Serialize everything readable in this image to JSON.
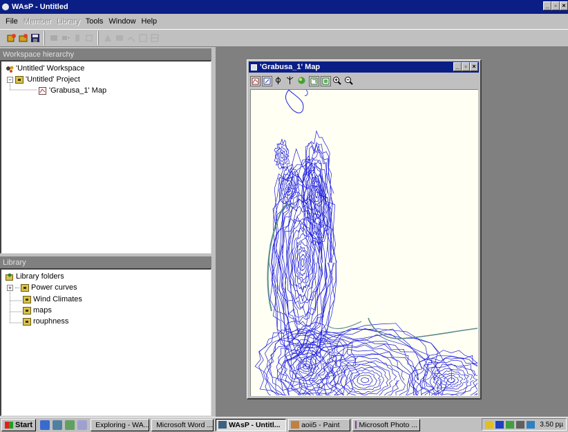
{
  "window": {
    "title": "WAsP - Untitled",
    "btn_min": "_",
    "btn_max": "▫",
    "btn_close": "×"
  },
  "menu": [
    {
      "label": "File",
      "enabled": true
    },
    {
      "label": "Member",
      "enabled": false
    },
    {
      "label": "Library",
      "enabled": false
    },
    {
      "label": "Tools",
      "enabled": true
    },
    {
      "label": "Window",
      "enabled": true
    },
    {
      "label": "Help",
      "enabled": true
    }
  ],
  "workspace_panel": {
    "header": "Workspace hierarchy",
    "items": [
      {
        "label": "'Untitled' Workspace"
      },
      {
        "label": "'Untitled' Project",
        "expander": "−"
      },
      {
        "label": "'Grabusa_1' Map"
      }
    ]
  },
  "library_panel": {
    "header": "Library",
    "items": [
      {
        "label": "Library folders"
      },
      {
        "label": "Power curves",
        "expander": "+"
      },
      {
        "label": "Wind Climates"
      },
      {
        "label": "maps"
      },
      {
        "label": "rouphness"
      }
    ]
  },
  "map_window": {
    "title": "'Grabusa_1' Map"
  },
  "taskbar": {
    "start_label": "Start",
    "tasks": [
      {
        "label": "Exploring - WA...",
        "active": false
      },
      {
        "label": "Microsoft Word ...",
        "active": false
      },
      {
        "label": "WAsP - Untitl...",
        "active": true
      },
      {
        "label": "aoii5 - Paint",
        "active": false
      },
      {
        "label": "Microsoft Photo ...",
        "active": false
      }
    ],
    "clock": "3.50 pµ"
  },
  "colors": {
    "title_bar": "#0a1e86",
    "contour": "#1a1ae0",
    "coastline": "#5a8a8a",
    "map_background": "#fffff4"
  }
}
